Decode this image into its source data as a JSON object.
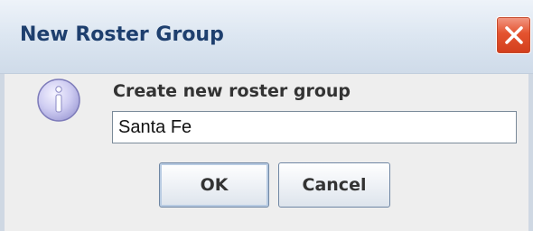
{
  "dialog": {
    "title": "New Roster Group",
    "message": "Create new roster group",
    "input_value": "Santa Fe",
    "ok_label": "OK",
    "cancel_label": "Cancel",
    "icon": "info-icon"
  },
  "colors": {
    "title_text": "#1e3f6e",
    "close_button": "#e4532f",
    "dialog_background": "#eeeeee",
    "info_icon_fill": "#c9c8ef"
  }
}
